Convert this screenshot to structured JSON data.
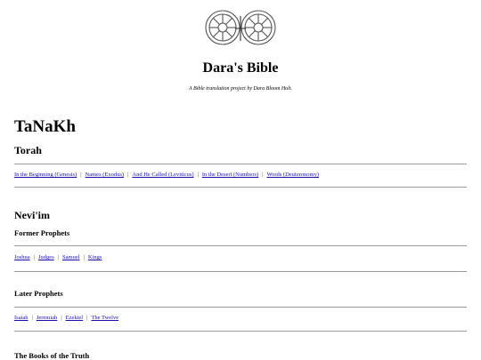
{
  "header": {
    "title": "Dara's Bible",
    "subtitle": "A Bible translation project by Dara Bloom Holt."
  },
  "main": {
    "heading": "TaNaKh",
    "torah": {
      "heading": "Torah",
      "links": [
        "In the Beginning (Genesis)",
        "Names (Exodus)",
        "And He Called (Leviticus)",
        "In the Desert (Numbers)",
        "Words (Deuteronomy)"
      ]
    },
    "neviim": {
      "heading": "Nevi'im",
      "former": {
        "heading": "Former Prophets",
        "links": [
          "Joshua",
          "Judges",
          "Samuel",
          "Kings"
        ]
      },
      "later": {
        "heading": "Later Prophets",
        "links": [
          "Isaiah",
          "Jeremiah",
          "Ezekiel",
          "The Twelve"
        ]
      }
    },
    "truth": {
      "heading": "The Books of the Truth"
    }
  },
  "separator": "|"
}
